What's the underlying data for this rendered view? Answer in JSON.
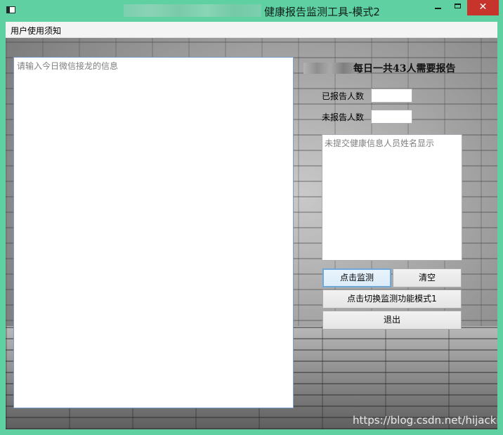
{
  "window": {
    "title": "健康报告监测工具-模式2",
    "min_glyph": "",
    "close_glyph": "✕"
  },
  "menu": {
    "items": [
      {
        "label": "用户使用须知"
      }
    ]
  },
  "main_input": {
    "placeholder": "请输入今日微信接龙的信息"
  },
  "summary": {
    "heading": "每日一共43人需要报告",
    "total_required": 43
  },
  "fields": {
    "reported_label": "已报告人数",
    "reported_value": "",
    "unreported_label": "未报告人数",
    "unreported_value": ""
  },
  "names_box": {
    "placeholder": "未提交健康信息人员姓名显示"
  },
  "buttons": {
    "detect": "点击监测",
    "clear": "清空",
    "switch_mode": "点击切换监测功能模式1",
    "exit": "退出"
  },
  "watermark": "https://blog.csdn.net/hijacklei",
  "colors": {
    "titlebar": "#5fd0a2",
    "close_button": "#c7342c",
    "focused_button_border": "#6fa7d8"
  }
}
